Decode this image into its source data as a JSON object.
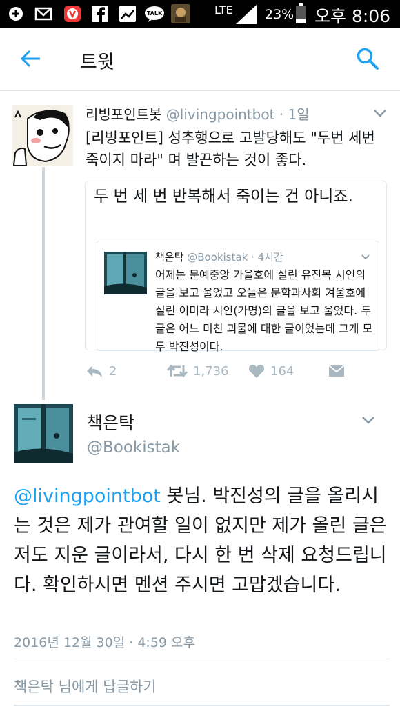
{
  "status_bar": {
    "network": "LTE",
    "battery": "23%",
    "time": "오후 8:06",
    "icons": [
      "plus-icon",
      "mail-icon",
      "vivaldi-icon",
      "facebook-icon",
      "gallery-icon",
      "kakaotalk-icon",
      "game-icon",
      "signal-icon",
      "battery-icon"
    ],
    "kakao_label": "TALK"
  },
  "header": {
    "title": "트윗"
  },
  "quoted_tweet": {
    "name": "리빙포인트봇",
    "handle": "@livingpointbot",
    "time": "· 1일",
    "text": "[리빙포인트] 성추행으로 고발당해도 \"두번 세번 죽이지 마라\" 며 발끈하는 것이 좋다.",
    "card": {
      "comment": "두 번 세 번 반복해서 죽이는 건 아니죠.",
      "inner": {
        "name": "책은탁",
        "handle": "@Bookistak",
        "time": "· 4시간",
        "text": "어제는 문예중앙 가을호에 실린 유진목 시인의 글을 보고 울었고 오늘은 문학과사회 겨울호에 실린 이미라 시인(가명)의 글을 보고 울었다. 두 글은 어느 미친 괴물에 대한 글이었는데 그게 모두 박진성이다."
      }
    },
    "actions": {
      "replies": "2",
      "retweets": "1,736",
      "likes": "164"
    }
  },
  "main_tweet": {
    "name": "책은탁",
    "handle": "@Bookistak",
    "mention": "@livingpointbot",
    "text": " 봇님. 박진성의 글을 올리시는 것은 제가 관여할 일이 없지만 제가 올린 글은 저도 지운 글이라서, 다시 한 번 삭제 요청드립니다. 확인하시면 멘션 주시면 고맙겠습니다.",
    "timestamp": "2016년 12월 30일 · 4:59 오후"
  },
  "reply_prompt": "책은탁 님에게 답글하기",
  "colors": {
    "accent": "#1da1f2",
    "muted": "#8899a6",
    "border": "#e1e8ed",
    "status_bar": "#000000"
  }
}
